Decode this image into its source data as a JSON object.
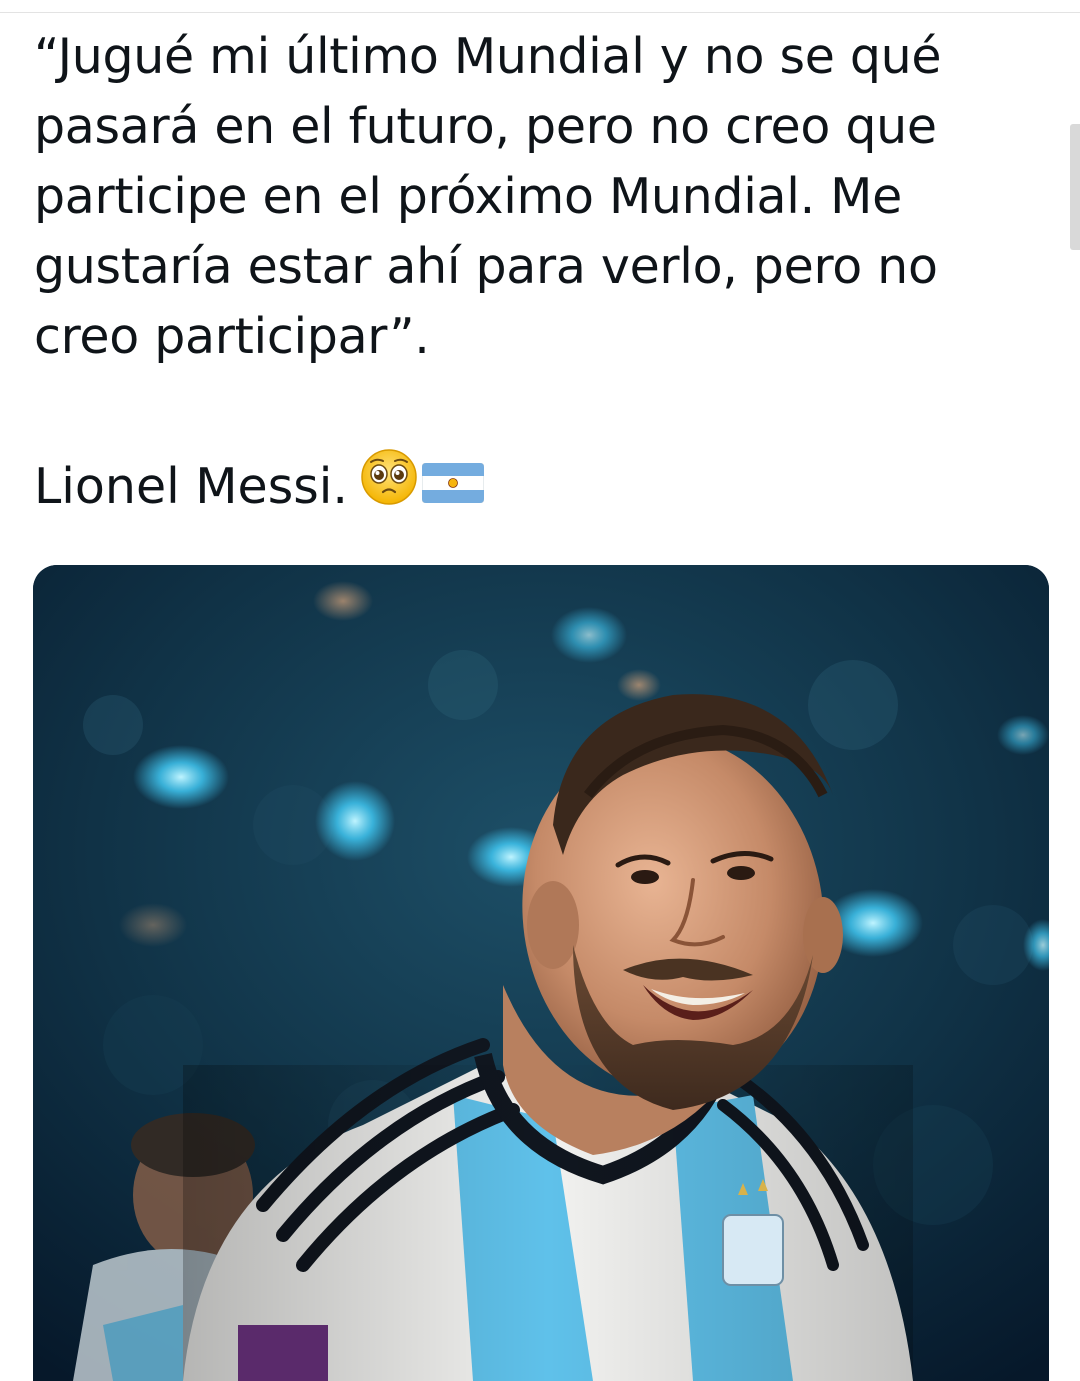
{
  "tweet": {
    "quote_lines": [
      "“Jugué mi último Mundial y no se qué",
      "pasará en el futuro, pero no creo que",
      "participe en el próximo Mundial. Me",
      "gustaría estar ahí para verlo, pero no",
      "creo participar”."
    ],
    "author_text": "Lionel Messi.",
    "emojis": [
      "pleading-face-emoji",
      "argentina-flag-emoji"
    ]
  },
  "media": {
    "image_subject": "photo-of-smiling-footballer",
    "colors": {
      "stadium_bg": "#0a2233",
      "light_blue_stripe": "#5fc1ea",
      "jersey_white": "#f2f2f0",
      "stripe_dark": "#10161f"
    }
  }
}
